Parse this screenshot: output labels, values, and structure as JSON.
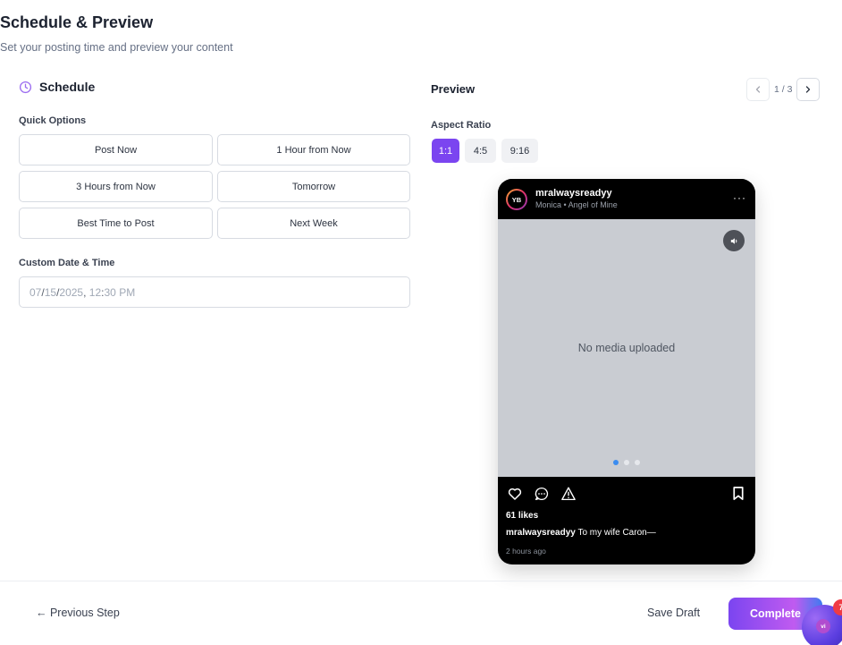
{
  "header": {
    "title": "Schedule & Preview",
    "subtitle": "Set your posting time and preview your content"
  },
  "schedule": {
    "heading": "Schedule",
    "quick_options_label": "Quick Options",
    "quick_options": [
      "Post Now",
      "1 Hour from Now",
      "3 Hours from Now",
      "Tomorrow",
      "Best Time to Post",
      "Next Week"
    ],
    "custom_label": "Custom Date & Time",
    "datetime": {
      "month": "07",
      "day": "15",
      "year": "2025",
      "hour": "12",
      "minute": "30",
      "ampm": "PM"
    }
  },
  "preview": {
    "heading": "Preview",
    "pager": {
      "current": "1",
      "total": "3",
      "sep": "/"
    },
    "aspect_label": "Aspect Ratio",
    "aspect_options": [
      "1:1",
      "4:5",
      "9:16"
    ],
    "aspect_selected": "1:1",
    "post": {
      "avatar_initials": "YB",
      "username": "mralwaysreadyy",
      "song": "Monica • Angel of Mine",
      "more": "···",
      "empty_media": "No media uploaded",
      "carousel_count": 3,
      "carousel_active": 1,
      "likes": "61 likes",
      "caption_user": "mralwaysreadyy",
      "caption_text": "To my wife Caron—",
      "time_ago": "2 hours ago"
    }
  },
  "footer": {
    "previous_label": "← Previous Step",
    "save_draft_label": "Save Draft",
    "complete_label": "Complete",
    "chat_initials": "vi",
    "chat_badge": "7"
  },
  "colors": {
    "accent": "#7b45f0",
    "clock_icon": "#9b6cf0",
    "carousel_active_dot": "#3b8cf0",
    "badge": "#ef3b45"
  }
}
